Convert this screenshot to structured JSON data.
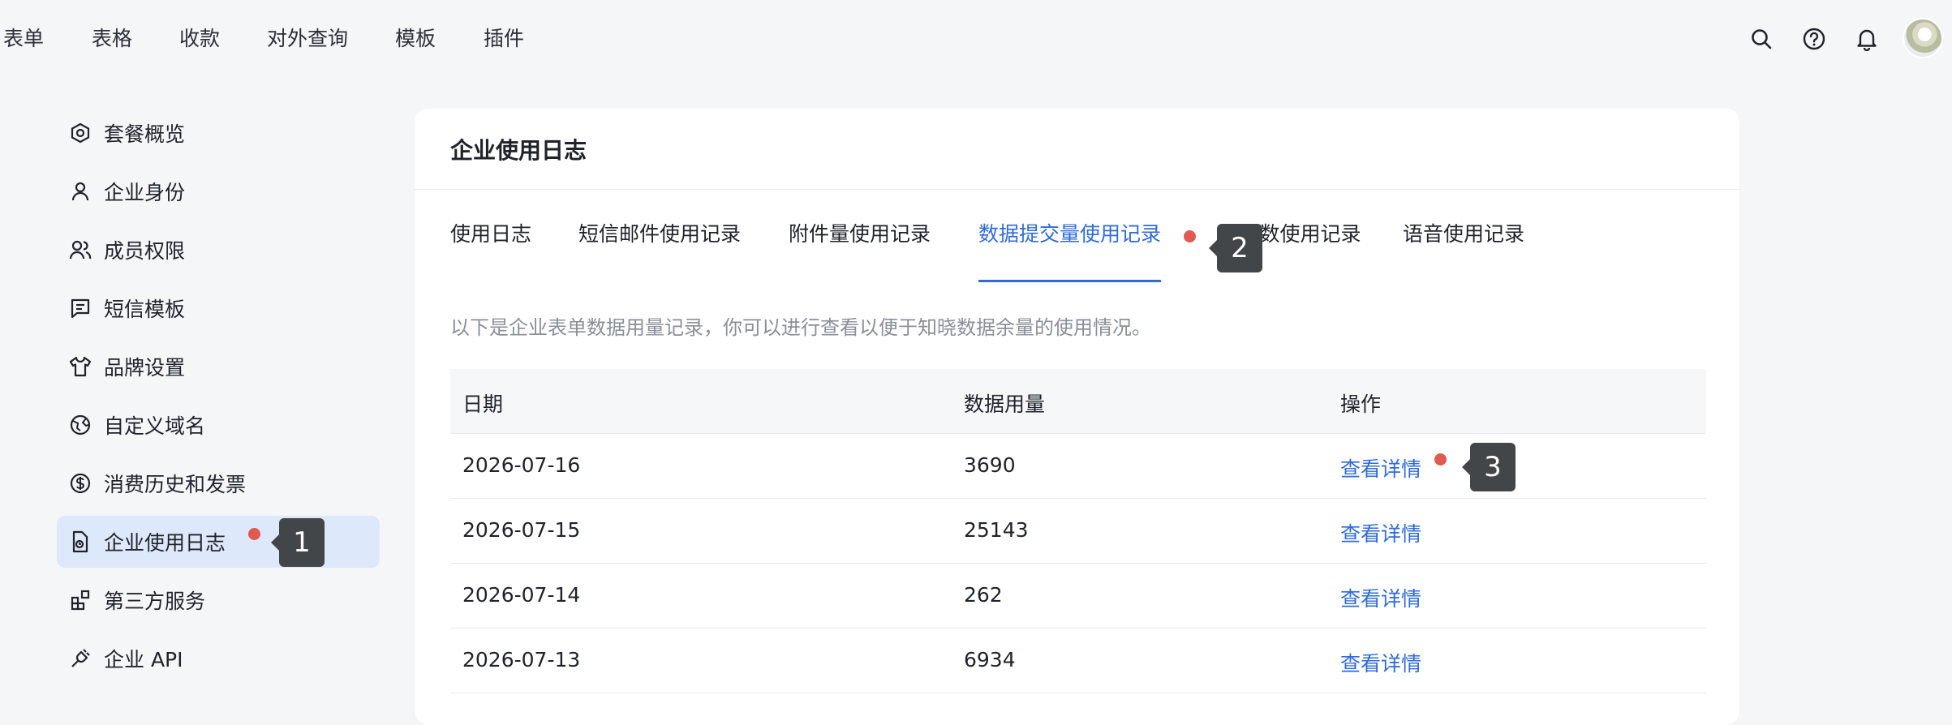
{
  "topnav": {
    "tabs": [
      "表单",
      "表格",
      "收款",
      "对外查询",
      "模板",
      "插件"
    ],
    "icons": [
      "search-icon",
      "help-icon",
      "bell-icon"
    ]
  },
  "sidebar": {
    "items": [
      {
        "label": "套餐概览",
        "icon": "package-icon"
      },
      {
        "label": "企业身份",
        "icon": "user-icon"
      },
      {
        "label": "成员权限",
        "icon": "users-icon"
      },
      {
        "label": "短信模板",
        "icon": "message-icon"
      },
      {
        "label": "品牌设置",
        "icon": "shirt-icon"
      },
      {
        "label": "自定义域名",
        "icon": "globe-icon"
      },
      {
        "label": "消费历史和发票",
        "icon": "dollar-icon"
      },
      {
        "label": "企业使用日志",
        "icon": "log-icon"
      },
      {
        "label": "第三方服务",
        "icon": "apps-icon"
      },
      {
        "label": "企业 API",
        "icon": "plug-icon"
      }
    ],
    "active_index": 7
  },
  "main": {
    "title": "企业使用日志",
    "tabs": [
      "使用日志",
      "短信邮件使用记录",
      "附件量使用记录",
      "数据提交量使用记录",
      "AI点数使用记录",
      "语音使用记录"
    ],
    "active_tab_index": 3,
    "description": "以下是企业表单数据用量记录，你可以进行查看以便于知晓数据余量的使用情况。",
    "table": {
      "headers": [
        "日期",
        "数据用量",
        "操作"
      ],
      "rows": [
        {
          "date": "2026-07-16",
          "usage": "3690",
          "action": "查看详情"
        },
        {
          "date": "2026-07-15",
          "usage": "25143",
          "action": "查看详情"
        },
        {
          "date": "2026-07-14",
          "usage": "262",
          "action": "查看详情"
        },
        {
          "date": "2026-07-13",
          "usage": "6934",
          "action": "查看详情"
        }
      ]
    }
  },
  "markers": [
    "1",
    "2",
    "3"
  ],
  "colors": {
    "accent": "#2f6bda",
    "active_bg": "#dde8fb",
    "dot": "#e05a4f",
    "marker_bg": "#434649"
  }
}
